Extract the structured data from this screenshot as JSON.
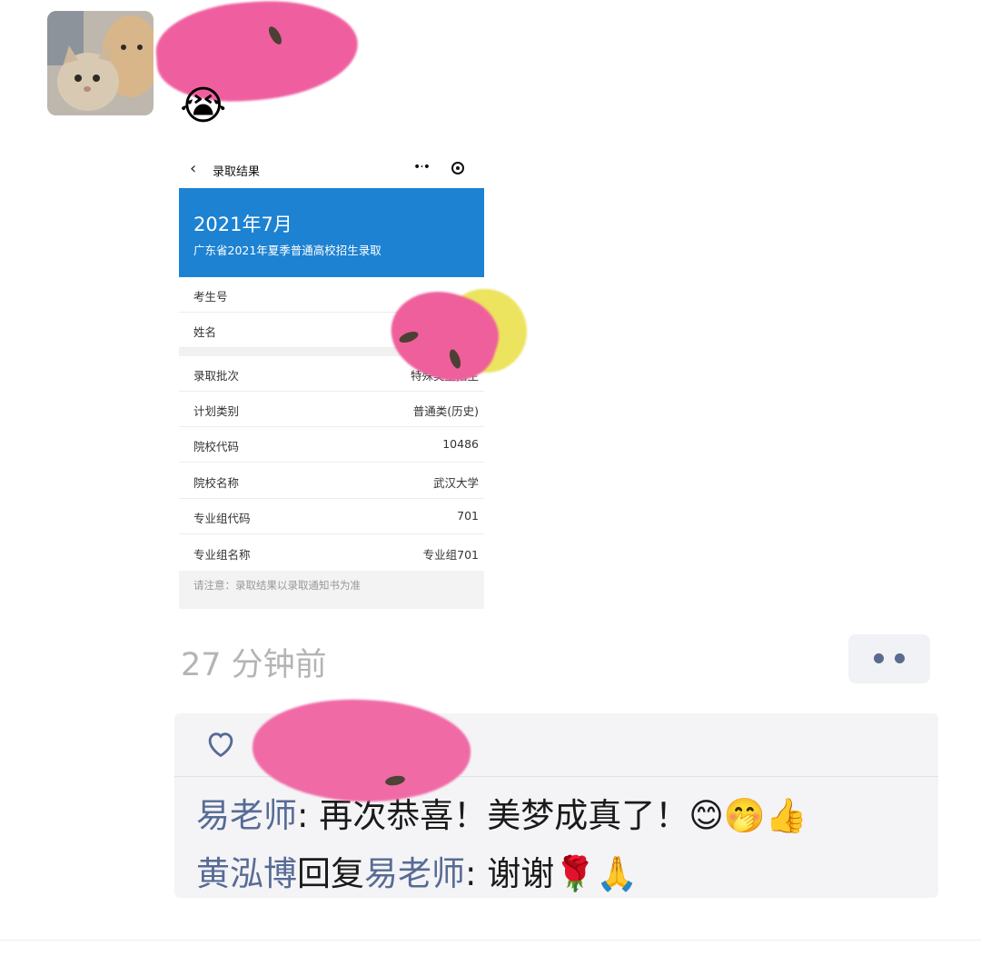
{
  "post": {
    "emoji": "😭",
    "card": {
      "page_title": "录取结果",
      "hero_date": "2021年7月",
      "hero_subtitle": "广东省2021年夏季普通高校招生录取",
      "rows": [
        {
          "label": "考生号",
          "value": ""
        },
        {
          "label": "姓名",
          "value": ""
        },
        {
          "label": "录取批次",
          "value": "特殊类型招生"
        },
        {
          "label": "计划类别",
          "value": "普通类(历史)"
        },
        {
          "label": "院校代码",
          "value": "10486"
        },
        {
          "label": "院校名称",
          "value": "武汉大学"
        },
        {
          "label": "专业组代码",
          "value": "701"
        },
        {
          "label": "专业组名称",
          "value": "专业组701"
        }
      ],
      "notice": "请注意：录取结果以录取通知书为准"
    },
    "time": "27 分钟前"
  },
  "comments": [
    {
      "author": "易老师",
      "sep": ": ",
      "text": "再次恭喜！美梦成真了！😊🤭👍"
    },
    {
      "author": "黄泓博",
      "reply_word": "回复",
      "reply_to": "易老师",
      "sep": ": ",
      "text": "谢谢🌹🙏"
    }
  ],
  "colors": {
    "nickname": "#576b95",
    "hero_blue": "#1d82d2",
    "time_gray": "#b4b4b4"
  },
  "icons": [
    "back-icon",
    "more-icon",
    "target-icon",
    "heart-icon",
    "more-dots-icon"
  ]
}
